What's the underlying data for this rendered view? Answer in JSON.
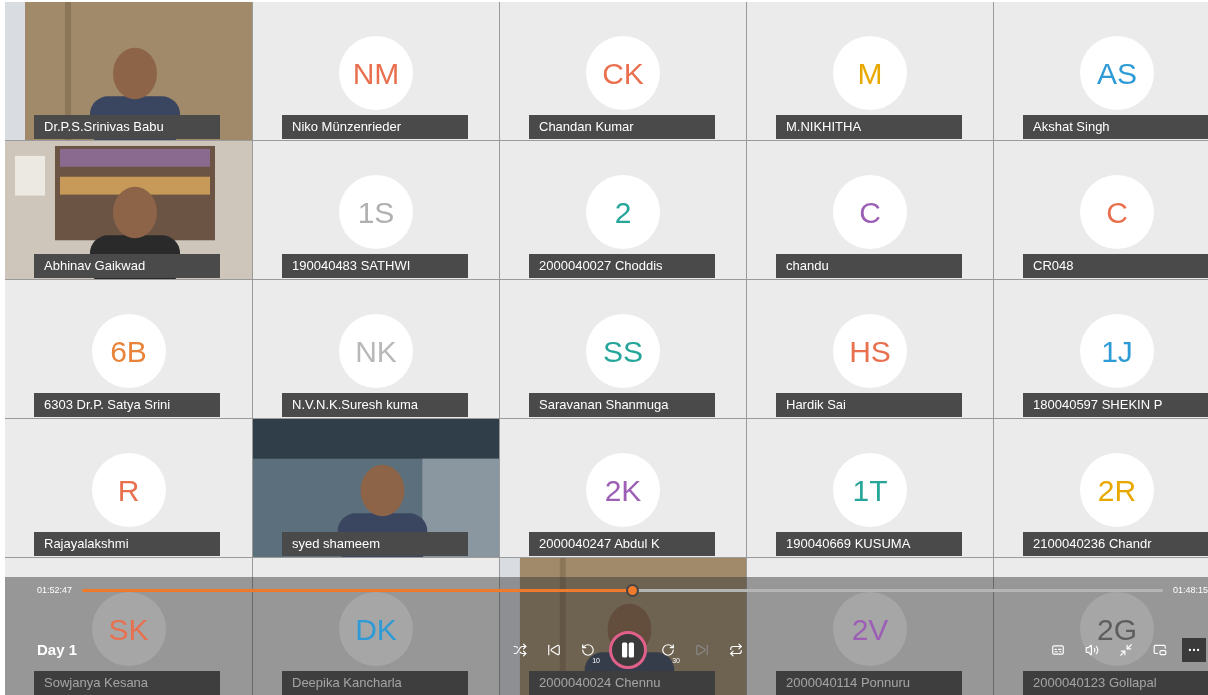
{
  "tiles": [
    {
      "kind": "video",
      "name": "Dr.P.S.Srinivas Babu"
    },
    {
      "kind": "avatar",
      "initials": "NM",
      "color": "#e8704f",
      "name": "Niko Münzenrieder"
    },
    {
      "kind": "avatar",
      "initials": "CK",
      "color": "#e8704f",
      "name": "Chandan Kumar"
    },
    {
      "kind": "avatar",
      "initials": "M",
      "color": "#e8a800",
      "name": "M.NIKHITHA"
    },
    {
      "kind": "avatar",
      "initials": "AS",
      "color": "#2e9bd6",
      "name": "Akshat Singh"
    },
    {
      "kind": "video",
      "name": "Abhinav Gaikwad"
    },
    {
      "kind": "avatar",
      "initials": "1S",
      "color": "#b0b0b0",
      "name": "190040483 SATHWI"
    },
    {
      "kind": "avatar",
      "initials": "2",
      "color": "#26a69a",
      "name": "2000040027 Choddis"
    },
    {
      "kind": "avatar",
      "initials": "C",
      "color": "#9c5fb5",
      "name": "chandu"
    },
    {
      "kind": "avatar",
      "initials": "C",
      "color": "#e8704f",
      "name": "CR048"
    },
    {
      "kind": "avatar",
      "initials": "6B",
      "color": "#e8843a",
      "name": "6303 Dr.P. Satya Srini"
    },
    {
      "kind": "avatar",
      "initials": "NK",
      "color": "#b8b8b8",
      "name": "N.V.N.K.Suresh kuma"
    },
    {
      "kind": "avatar",
      "initials": "SS",
      "color": "#26a69a",
      "name": "Saravanan Shanmuga"
    },
    {
      "kind": "avatar",
      "initials": "HS",
      "color": "#e8704f",
      "name": "Hardik Sai"
    },
    {
      "kind": "avatar",
      "initials": "1J",
      "color": "#2e9bd6",
      "name": "180040597 SHEKIN P"
    },
    {
      "kind": "avatar",
      "initials": "R",
      "color": "#e8704f",
      "name": "Rajayalakshmi"
    },
    {
      "kind": "video",
      "name": "syed shameem"
    },
    {
      "kind": "avatar",
      "initials": "2K",
      "color": "#9c5fb5",
      "name": "2000040247 Abdul K"
    },
    {
      "kind": "avatar",
      "initials": "1T",
      "color": "#26a69a",
      "name": "190040669 KUSUMA"
    },
    {
      "kind": "avatar",
      "initials": "2R",
      "color": "#e8a800",
      "name": "2100040236 Chandr"
    },
    {
      "kind": "avatar",
      "initials": "SK",
      "color": "#e8704f",
      "name": "Sowjanya Kesana"
    },
    {
      "kind": "avatar",
      "initials": "DK",
      "color": "#2e9bd6",
      "name": "Deepika Kancharla"
    },
    {
      "kind": "video",
      "name": "2000040024  Chennu"
    },
    {
      "kind": "avatar",
      "initials": "2V",
      "color": "#9c5fb5",
      "name": "2000040114 Ponnuru"
    },
    {
      "kind": "avatar",
      "initials": "2G",
      "color": "#5e5e5e",
      "name": "2000040123 Gollapal"
    }
  ],
  "player": {
    "elapsed": "01:52:47",
    "remaining": "01:48:15",
    "level": 0.51,
    "title": "Day 1",
    "controls": [
      {
        "kind": "shuffle",
        "disabled": false
      },
      {
        "kind": "previous",
        "disabled": false
      },
      {
        "kind": "back",
        "label": "10",
        "disabled": false
      },
      {
        "kind": "pause",
        "disabled": false
      },
      {
        "kind": "forward",
        "label": "30",
        "disabled": false
      },
      {
        "kind": "next",
        "disabled": true
      },
      {
        "kind": "repeat",
        "disabled": false
      }
    ],
    "tools": [
      {
        "kind": "captions"
      },
      {
        "kind": "volume"
      },
      {
        "kind": "minimize"
      },
      {
        "kind": "popout"
      },
      {
        "kind": "more"
      }
    ]
  }
}
